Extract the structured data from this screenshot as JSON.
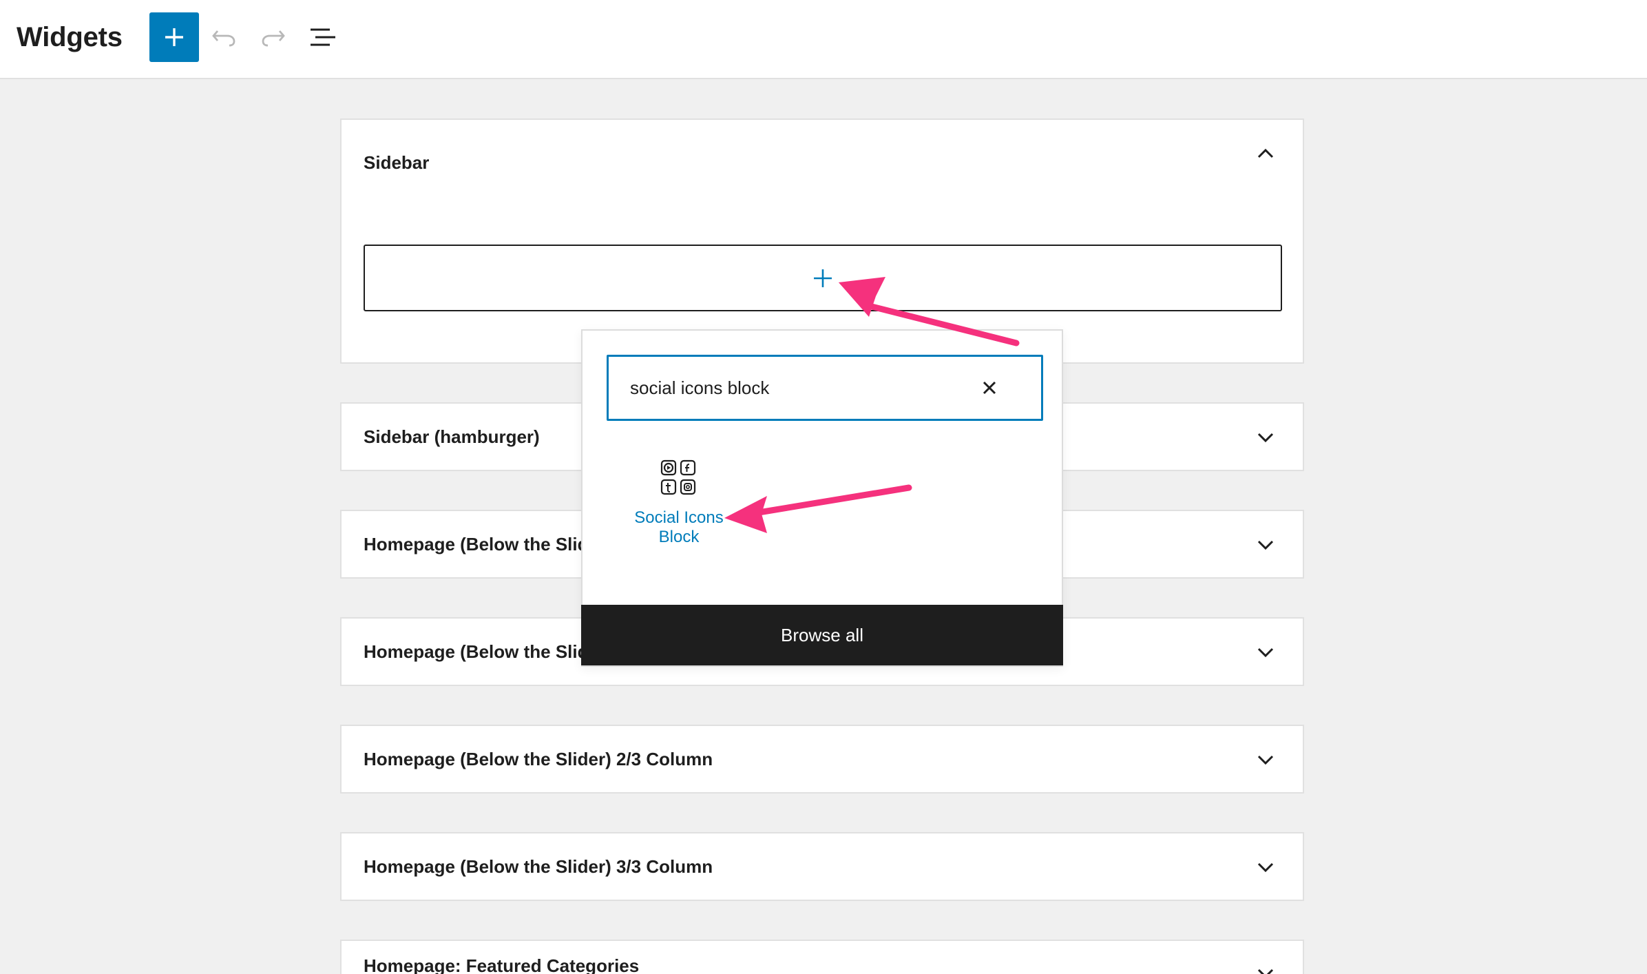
{
  "header": {
    "title": "Widgets",
    "add_button_label": "+",
    "icons": [
      "plus-icon",
      "undo-icon",
      "redo-icon",
      "list-view-icon"
    ]
  },
  "widget_areas": [
    {
      "title": "Sidebar",
      "state": "expanded"
    },
    {
      "title": "Sidebar (hamburger)",
      "state": "collapsed"
    },
    {
      "title": "Homepage (Below the Slid",
      "state": "collapsed"
    },
    {
      "title": "Homepage (Below the Slid",
      "state": "collapsed"
    },
    {
      "title": "Homepage (Below the Slider) 2/3 Column",
      "state": "collapsed"
    },
    {
      "title": "Homepage (Below the Slider) 3/3 Column",
      "state": "collapsed"
    },
    {
      "title": "Homepage: Featured Categories",
      "state": "collapsed"
    }
  ],
  "inserter": {
    "search_value": "social icons block",
    "results": [
      {
        "label": "Social Icons Block",
        "icon": "social-icons-block-icon"
      }
    ],
    "browse_all_label": "Browse all"
  },
  "colors": {
    "accent": "#007cba",
    "annotation_arrow": "#f5317d",
    "dark": "#1e1e1e"
  }
}
